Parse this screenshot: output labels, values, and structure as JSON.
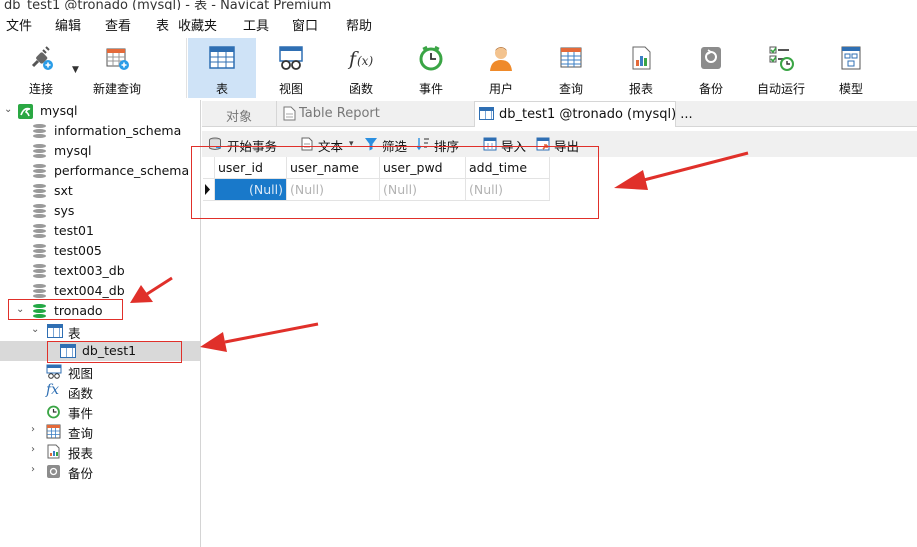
{
  "window": {
    "title": "db_test1 @tronado (mysql) - 表 - Navicat Premium"
  },
  "menu": [
    "文件",
    "编辑",
    "查看",
    "表",
    "收藏夹",
    "工具",
    "窗口",
    "帮助"
  ],
  "toolbar": {
    "connect": "连接",
    "new_query": "新建查询",
    "table": "表",
    "view": "视图",
    "function": "函数",
    "event": "事件",
    "user": "用户",
    "query": "查询",
    "report": "报表",
    "backup": "备份",
    "automation": "自动运行",
    "model": "模型"
  },
  "tree": {
    "connection": "mysql",
    "databases": [
      "information_schema",
      "mysql",
      "performance_schema",
      "sxt",
      "sys",
      "test01",
      "test005",
      "text003_db",
      "text004_db"
    ],
    "open_db": "tronado",
    "tables_group": "表",
    "table_item": "db_test1",
    "views": "视图",
    "functions": "函数",
    "events": "事件",
    "queries": "查询",
    "reports": "报表",
    "backups": "备份"
  },
  "tabs": {
    "objects": "对象",
    "report": "Table Report",
    "active": "db_test1 @tronado (mysql) ..."
  },
  "subtoolbar": {
    "begin_tx": "开始事务",
    "text": "文本",
    "filter": "筛选",
    "sort": "排序",
    "import": "导入",
    "export": "导出"
  },
  "grid": {
    "columns": [
      "user_id",
      "user_name",
      "user_pwd",
      "add_time"
    ],
    "row": [
      "(Null)",
      "(Null)",
      "(Null)",
      "(Null)"
    ]
  },
  "colors": {
    "accent": "#1979ca",
    "annotation_red": "#e0302a",
    "db_green": "#23a844"
  }
}
